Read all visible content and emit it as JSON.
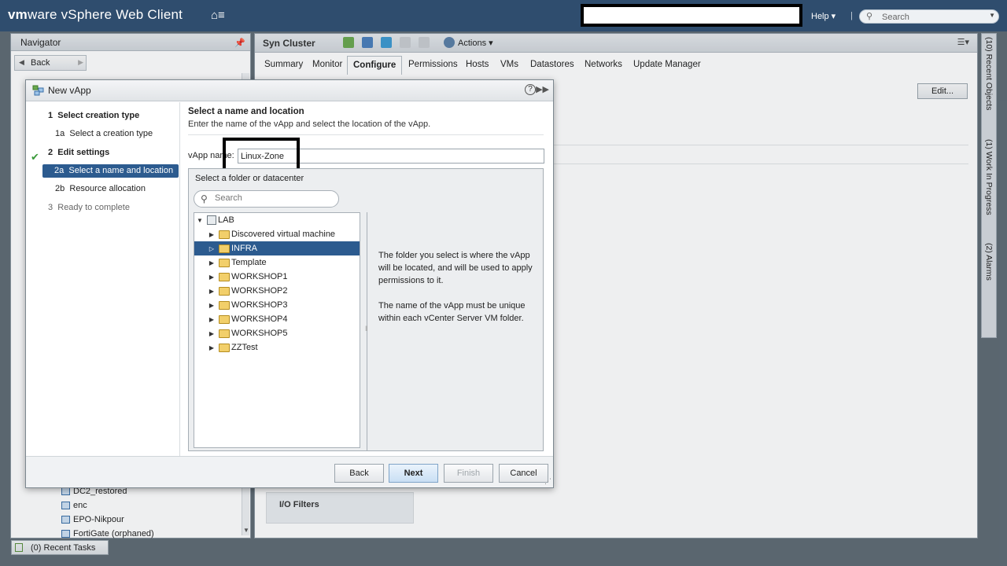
{
  "header": {
    "brand_vm": "vm",
    "brand_ware": "ware",
    "brand_product": "vSphere Web Client",
    "help": "Help",
    "separator": "|",
    "search_placeholder": "Search"
  },
  "navigator": {
    "title": "Navigator",
    "back": "Back",
    "items": [
      "DC2_restored",
      "enc",
      "EPO-Nikpour",
      "FortiGate (orphaned)"
    ]
  },
  "main": {
    "title": "Syn Cluster",
    "actions": "Actions",
    "tabs": [
      "Summary",
      "Monitor",
      "Configure",
      "Permissions",
      "Hosts",
      "VMs",
      "Datastores",
      "Networks",
      "Update Manager"
    ],
    "active_tab": "Configure",
    "edit_button": "Edit...",
    "io_filters": "I/O Filters"
  },
  "side_panel": {
    "recent_objects": "(10) Recent Objects",
    "work_in_progress": "(1) Work In Progress",
    "alarms": "(2) Alarms"
  },
  "recent_tasks": "(0) Recent Tasks",
  "dialog": {
    "title": "New vApp",
    "steps": [
      {
        "num": "1",
        "label": "Select creation type"
      },
      {
        "num": "1a",
        "label": "Select a creation type"
      },
      {
        "num": "2",
        "label": "Edit settings"
      },
      {
        "num": "2a",
        "label": "Select a name and location"
      },
      {
        "num": "2b",
        "label": "Resource allocation"
      },
      {
        "num": "3",
        "label": "Ready to complete"
      }
    ],
    "section_title": "Select a name and location",
    "section_desc": "Enter the name of the vApp and select the location of the vApp.",
    "name_label": "vApp name:",
    "name_value": "Linux-Zone",
    "folder_title": "Select a folder or datacenter",
    "folder_search_placeholder": "Search",
    "tree": {
      "root": "LAB",
      "children": [
        "Discovered virtual machine",
        "INFRA",
        "Template",
        "WORKSHOP1",
        "WORKSHOP2",
        "WORKSHOP3",
        "WORKSHOP4",
        "WORKSHOP5",
        "ZZTest"
      ],
      "selected": "INFRA"
    },
    "info_p1": "The folder you select is where the vApp will be located, and will be used to apply permissions to it.",
    "info_p2": "The name of the vApp must be unique within each vCenter Server VM folder.",
    "buttons": {
      "back": "Back",
      "next": "Next",
      "finish": "Finish",
      "cancel": "Cancel"
    }
  },
  "colors": {
    "header_bg": "#2f4d6e",
    "selection": "#2c5b8f",
    "folder": "#f2cf6a"
  }
}
